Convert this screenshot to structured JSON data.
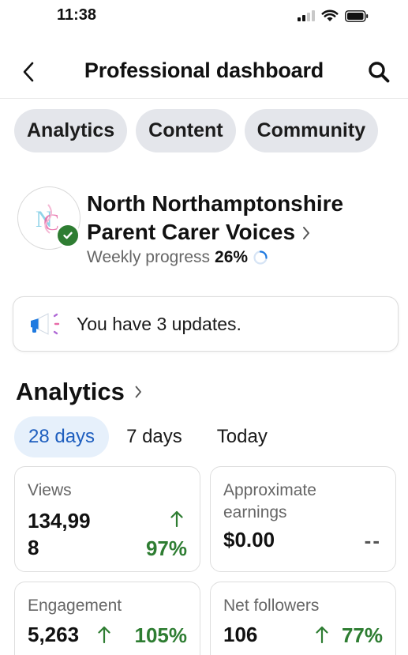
{
  "status_bar": {
    "time": "11:38"
  },
  "header": {
    "title": "Professional dashboard"
  },
  "tabs": [
    {
      "label": "Analytics"
    },
    {
      "label": "Content"
    },
    {
      "label": "Community"
    }
  ],
  "profile": {
    "name": "North Northamptonshire Parent Carer Voices",
    "progress_label": "Weekly progress",
    "progress_value": "26%",
    "progress_fraction": 0.26
  },
  "updates": {
    "text": "You have 3 updates."
  },
  "analytics": {
    "heading": "Analytics",
    "ranges": [
      {
        "label": "28 days",
        "selected": true
      },
      {
        "label": "7 days",
        "selected": false
      },
      {
        "label": "Today",
        "selected": false
      }
    ],
    "cards": {
      "views": {
        "label": "Views",
        "value_line1": "134,99",
        "value_line2": "8",
        "change": "97%"
      },
      "earnings": {
        "label_line1": "Approximate",
        "label_line2": "earnings",
        "value": "$0.00",
        "change": "--"
      },
      "engagement": {
        "label": "Engagement",
        "value": "5,263",
        "change": "105%"
      },
      "followers": {
        "label": "Net followers",
        "value": "106",
        "change": "77%"
      }
    }
  },
  "colors": {
    "accent_blue": "#1f5fbf",
    "positive_green": "#2e7d32",
    "pill_gray": "#e4e6eb"
  }
}
